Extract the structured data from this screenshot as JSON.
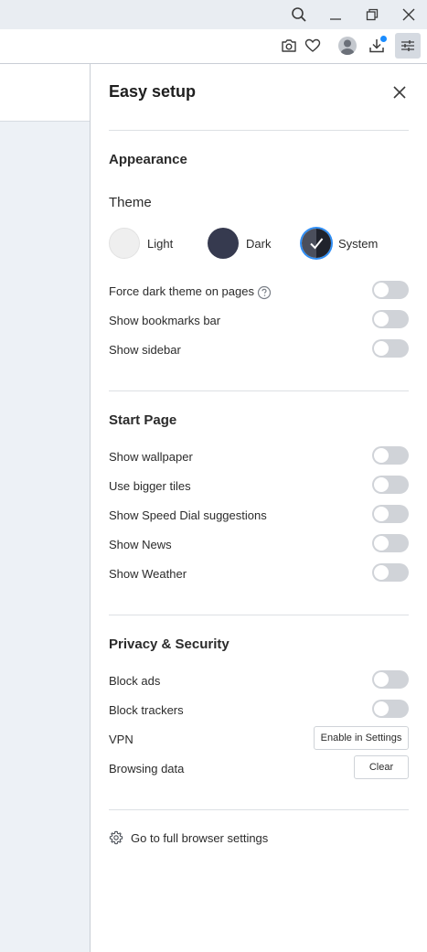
{
  "titlebar": {
    "icons": [
      "search-icon",
      "minimize-icon",
      "restore-icon",
      "close-icon"
    ]
  },
  "toolbar": {
    "icons": [
      "camera-icon",
      "heart-icon",
      "profile-icon",
      "download-icon",
      "easy-setup-icon"
    ]
  },
  "panel": {
    "title": "Easy setup",
    "appearance": {
      "heading": "Appearance",
      "theme_label": "Theme",
      "themes": [
        {
          "label": "Light",
          "selected": false
        },
        {
          "label": "Dark",
          "selected": false
        },
        {
          "label": "System",
          "selected": true
        }
      ],
      "toggles": [
        {
          "label": "Force dark theme on pages",
          "on": false
        },
        {
          "label": "Show bookmarks bar",
          "on": false
        },
        {
          "label": "Show sidebar",
          "on": false
        }
      ]
    },
    "start_page": {
      "heading": "Start Page",
      "toggles": [
        {
          "label": "Show wallpaper",
          "on": false
        },
        {
          "label": "Use bigger tiles",
          "on": false
        },
        {
          "label": "Show Speed Dial suggestions",
          "on": false
        },
        {
          "label": "Show News",
          "on": false
        },
        {
          "label": "Show Weather",
          "on": false
        }
      ]
    },
    "privacy": {
      "heading": "Privacy & Security",
      "toggles": [
        {
          "label": "Block ads",
          "on": false
        },
        {
          "label": "Block trackers",
          "on": false
        }
      ],
      "vpn_label": "VPN",
      "vpn_button": "Enable in Settings",
      "browsing_data_label": "Browsing data",
      "clear_button": "Clear"
    },
    "full_settings_link": "Go to full browser settings"
  },
  "colors": {
    "accent": "#2f8ef5",
    "toggle_off": "#d0d3d8",
    "titlebar": "#e9edf2",
    "page_background": "#edf1f6"
  }
}
